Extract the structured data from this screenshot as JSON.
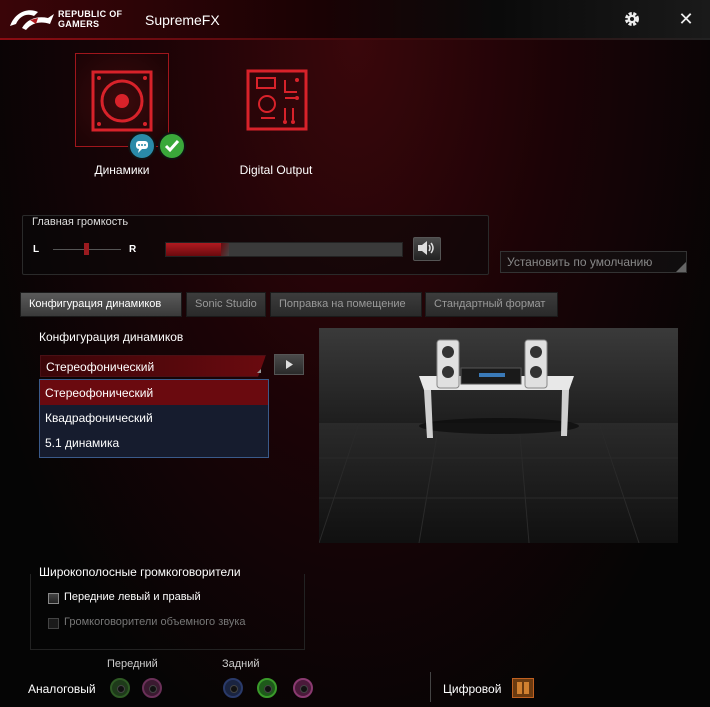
{
  "titlebar": {
    "brand_line1": "REPUBLIC OF",
    "brand_line2": "GAMERS",
    "app_title": "SupremeFX",
    "settings_icon": "gear-icon",
    "close_icon": "close-icon",
    "close_glyph": "✕"
  },
  "devices": [
    {
      "label": "Динамики",
      "selected": true,
      "icon": "speaker-icon"
    },
    {
      "label": "Digital Output",
      "selected": false,
      "icon": "circuit-board-icon"
    }
  ],
  "volume": {
    "title": "Главная громкость",
    "left_label": "L",
    "right_label": "R",
    "level_fraction": 0.25,
    "mute_icon": "speaker-volume-icon"
  },
  "default_button": {
    "label": "Установить по умолчанию"
  },
  "tabs": [
    {
      "label": "Конфигурация динамиков",
      "active": true
    },
    {
      "label": "Sonic Studio",
      "active": false
    },
    {
      "label": "Поправка на помещение",
      "active": false
    },
    {
      "label": "Стандартный формат",
      "active": false
    }
  ],
  "speaker_config": {
    "label": "Конфигурация динамиков",
    "selected": "Стереофонический",
    "options": [
      "Стереофонический",
      "Квадрафонический",
      "5.1 динамика"
    ]
  },
  "wideband": {
    "title": "Широкополосные громкоговорители",
    "options": [
      {
        "label": "Передние левый и правый",
        "checked": false,
        "enabled": true
      },
      {
        "label": "Громкоговорители объемного звука",
        "checked": false,
        "enabled": false
      }
    ]
  },
  "bottom": {
    "analog_label": "Аналоговый",
    "front_label": "Передний",
    "rear_label": "Задний",
    "digital_label": "Цифровой"
  },
  "colors": {
    "accent_red": "#a0161c",
    "jack_green": "#3a8a2a",
    "jack_pink": "#a05080",
    "jack_blue": "#2a4a9a"
  }
}
